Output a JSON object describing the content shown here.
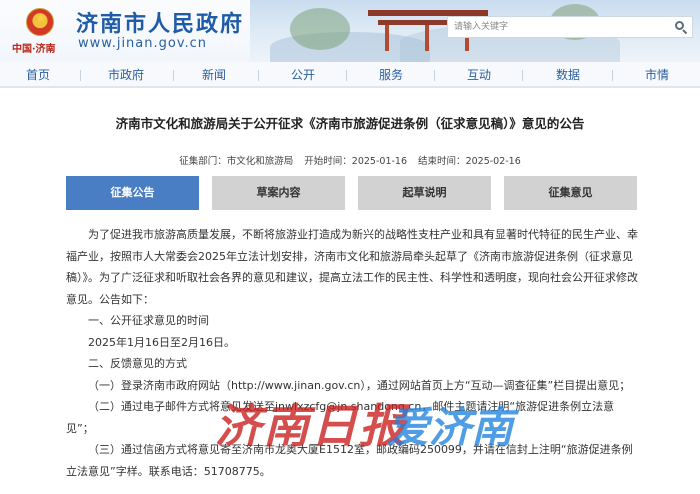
{
  "site": {
    "title": "济南市人民政府",
    "url": "www.jinan.gov.cn",
    "emblem_slogan": "中国·济南"
  },
  "search": {
    "placeholder": "请输入关键字"
  },
  "nav": {
    "items": [
      "首页",
      "市政府",
      "新闻",
      "公开",
      "服务",
      "互动",
      "数据",
      "市情"
    ]
  },
  "article": {
    "title": "济南市文化和旅游局关于公开征求《济南市旅游促进条例（征求意见稿）》意见的公告",
    "dept_label": "征集部门：",
    "dept_value": "市文化和旅游局",
    "start_label": "开始时间：",
    "start_value": "2025-01-16",
    "end_label": "结束时间：",
    "end_value": "2025-02-16"
  },
  "tabs": [
    {
      "label": "征集公告",
      "active": true
    },
    {
      "label": "草案内容",
      "active": false
    },
    {
      "label": "起草说明",
      "active": false
    },
    {
      "label": "征集意见",
      "active": false
    }
  ],
  "body": {
    "p1": "为了促进我市旅游高质量发展，不断将旅游业打造成为新兴的战略性支柱产业和具有显著时代特征的民生产业、幸福产业，按照市人大常委会2025年立法计划安排，济南市文化和旅游局牵头起草了《济南市旅游促进条例（征求意见稿）》。为了广泛征求和听取社会各界的意见和建议，提高立法工作的民主性、科学性和透明度，现向社会公开征求修改意见。公告如下：",
    "h1": "一、公开征求意见的时间",
    "d1": "2025年1月16日至2月16日。",
    "h2": "二、反馈意见的方式",
    "m1": "（一）登录济南市政府网站（http://www.jinan.gov.cn），通过网站首页上方“互动—调查征集”栏目提出意见；",
    "m2": "（二）通过电子邮件方式将意见发送至jnwlxzcfg@jn.shandong.cn，邮件主题请注明“旅游促进条例立法意见”；",
    "m3": "（三）通过信函方式将意见寄至济南市龙奥大厦E1512室，邮政编码250099，并请在信封上注明“旅游促进条例立法意见”字样。联系电话：51708775。"
  },
  "watermark": {
    "red": "济南日报",
    "blue": "爱济南"
  }
}
